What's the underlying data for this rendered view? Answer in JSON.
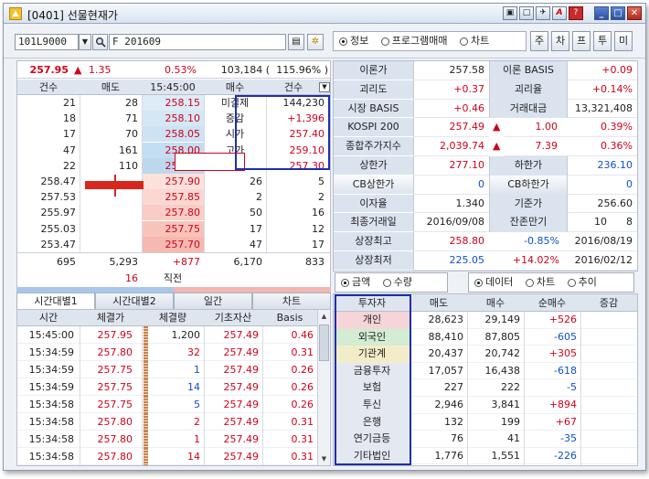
{
  "window": {
    "title": "[0401] 선물현재가"
  },
  "toolbar": {
    "code": "101L9000",
    "name": "F 201609",
    "radio1": [
      "정보",
      "프로그램매매",
      "차트"
    ],
    "radio1_selected": 0,
    "keys": [
      "주",
      "차",
      "프",
      "투",
      "미"
    ]
  },
  "summary": {
    "price": "257.95",
    "arrow": "▲",
    "change": "1.35",
    "pct": "0.53%",
    "volume": "103,184 (",
    "vol_pct": "115.96% )"
  },
  "book": {
    "headers": [
      "건수",
      "매도",
      "15:45:00",
      "매수",
      "건수"
    ],
    "asks": [
      {
        "cnt": "21",
        "qty": "28",
        "price": "258.15"
      },
      {
        "cnt": "18",
        "qty": "71",
        "price": "258.10"
      },
      {
        "cnt": "17",
        "qty": "70",
        "price": "258.05"
      },
      {
        "cnt": "47",
        "qty": "161",
        "price": "258.00"
      },
      {
        "cnt": "22",
        "qty": "110",
        "price": "257.95"
      }
    ],
    "bids": [
      {
        "price": "257.90",
        "qty": "26",
        "cnt": "5"
      },
      {
        "price": "257.85",
        "qty": "2",
        "cnt": "2"
      },
      {
        "price": "257.80",
        "qty": "50",
        "cnt": "16"
      },
      {
        "price": "257.75",
        "qty": "17",
        "cnt": "12"
      },
      {
        "price": "257.70",
        "qty": "47",
        "cnt": "17"
      }
    ],
    "left_side": [
      "258.47",
      "257.53",
      "255.97",
      "255.03",
      "253.47"
    ],
    "info": [
      {
        "label": "미결제",
        "value": "144,230"
      },
      {
        "label": "증감",
        "value": "+1,396"
      },
      {
        "label": "시가",
        "value": "257.40"
      },
      {
        "label": "고가",
        "value": "259.10"
      },
      {
        "label": "저가",
        "value": "257.30"
      }
    ],
    "totals": {
      "cnt_ask": "695",
      "qty_ask": "5,293",
      "diff": "+877",
      "qty_bid": "6,170",
      "cnt_bid": "833"
    },
    "extra": {
      "qty": "16",
      "label": "직전"
    }
  },
  "stats": [
    {
      "l1": "이론가",
      "v1": "257.58",
      "l2": "이론 BASIS",
      "v2": "+0.09"
    },
    {
      "l1": "괴리도",
      "v1": "+0.37",
      "l2": "괴리율",
      "v2": "+0.14%"
    },
    {
      "l1": "시장 BASIS",
      "v1": "+0.46",
      "l2": "거래대금",
      "v2": "13,321,408"
    },
    {
      "l1": "KOSPI 200",
      "v1": "257.49",
      "a1": "▲",
      "v1b": "1.00",
      "v2": "0.39%"
    },
    {
      "l1": "종합주가지수",
      "v1": "2,039.74",
      "a1": "▲",
      "v1b": "7.39",
      "v2": "0.36%"
    },
    {
      "l1": "상한가",
      "v1": "277.10",
      "l2": "하한가",
      "v2": "236.10"
    },
    {
      "l1": "CB상한가",
      "v1": "0",
      "l2": "CB하한가",
      "v2": "0"
    },
    {
      "l1": "이자율",
      "v1": "1.340",
      "l2": "기준가",
      "v2": "256.60"
    },
    {
      "l1": "최종거래일",
      "v1": "2016/09/08",
      "l2": "잔존만기",
      "v2a": "10",
      "v2": "8"
    },
    {
      "l1": "상장최고",
      "v1": "258.80",
      "v1b": "-0.85%",
      "v2": "2016/08/19"
    },
    {
      "l1": "상장최저",
      "v1": "225.05",
      "v1b": "+14.02%",
      "v2": "2016/02/12"
    }
  ],
  "ticks": {
    "tabs": [
      "시간대별1",
      "시간대별2",
      "일간",
      "차트"
    ],
    "headers": [
      "시간",
      "체결가",
      "체결량",
      "기초자산",
      "Basis"
    ],
    "rows": [
      {
        "t": "15:45:00",
        "p": "257.95",
        "q": "1,200",
        "b": "257.49",
        "s": "0.46",
        "qc": "dark"
      },
      {
        "t": "15:34:59",
        "p": "257.80",
        "q": "32",
        "b": "257.49",
        "s": "0.31",
        "qc": "red"
      },
      {
        "t": "15:34:59",
        "p": "257.75",
        "q": "1",
        "b": "257.49",
        "s": "0.26",
        "qc": "blue"
      },
      {
        "t": "15:34:59",
        "p": "257.75",
        "q": "14",
        "b": "257.49",
        "s": "0.26",
        "qc": "blue"
      },
      {
        "t": "15:34:58",
        "p": "257.75",
        "q": "5",
        "b": "257.49",
        "s": "0.26",
        "qc": "blue"
      },
      {
        "t": "15:34:58",
        "p": "257.80",
        "q": "2",
        "b": "257.49",
        "s": "0.31",
        "qc": "red"
      },
      {
        "t": "15:34:58",
        "p": "257.80",
        "q": "1",
        "b": "257.49",
        "s": "0.31",
        "qc": "red"
      },
      {
        "t": "15:34:58",
        "p": "257.80",
        "q": "14",
        "b": "257.49",
        "s": "0.31",
        "qc": "red"
      }
    ]
  },
  "investor": {
    "radio_a": [
      "금액",
      "수량"
    ],
    "radio_b": [
      "데이터",
      "차트",
      "추이"
    ],
    "headers": [
      "투자자",
      "매도",
      "매수",
      "순매수",
      "증감"
    ],
    "rows": [
      {
        "name": "개인",
        "sell": "28,623",
        "buy": "29,149",
        "net": "+526",
        "nc": "red",
        "bg": "#f6d5d8"
      },
      {
        "name": "외국인",
        "sell": "88,410",
        "buy": "87,805",
        "net": "-605",
        "nc": "blue",
        "bg": "#d3ecd2"
      },
      {
        "name": "기관계",
        "sell": "20,437",
        "buy": "20,742",
        "net": "+305",
        "nc": "red",
        "bg": "#f3ecc9"
      },
      {
        "name": "금융투자",
        "sell": "17,057",
        "buy": "16,438",
        "net": "-618",
        "nc": "blue",
        "bg": ""
      },
      {
        "name": "보험",
        "sell": "227",
        "buy": "222",
        "net": "-5",
        "nc": "blue",
        "bg": ""
      },
      {
        "name": "투신",
        "sell": "2,946",
        "buy": "3,841",
        "net": "+894",
        "nc": "red",
        "bg": ""
      },
      {
        "name": "은행",
        "sell": "132",
        "buy": "199",
        "net": "+67",
        "nc": "red",
        "bg": ""
      },
      {
        "name": "연기금등",
        "sell": "76",
        "buy": "41",
        "net": "-35",
        "nc": "blue",
        "bg": ""
      },
      {
        "name": "기타법인",
        "sell": "1,776",
        "buy": "1,551",
        "net": "-226",
        "nc": "blue",
        "bg": ""
      }
    ]
  },
  "colors": {
    "up": "#d0021b",
    "down": "#0f4fc9",
    "highlight": "#1d2fa8",
    "header": "#dfe5ef"
  }
}
